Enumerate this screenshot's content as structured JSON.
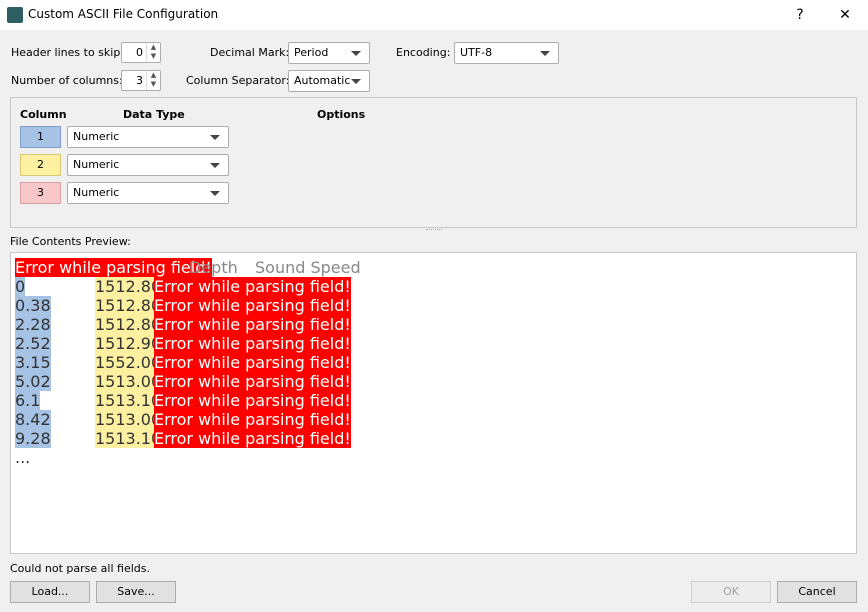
{
  "window": {
    "title": "Custom ASCII File Configuration",
    "help": "?",
    "close": "✕"
  },
  "settings": {
    "header_lines_label": "Header lines to skip:",
    "header_lines": "0",
    "num_columns_label": "Number of columns:",
    "num_columns": "3",
    "decimal_mark_label": "Decimal Mark:",
    "decimal_mark": "Period",
    "column_separator_label": "Column Separator:",
    "column_separator": "Automatic",
    "encoding_label": "Encoding:",
    "encoding": "UTF-8"
  },
  "columns": {
    "header_column": "Column",
    "header_type": "Data Type",
    "header_options": "Options",
    "rows": [
      {
        "num": "1",
        "type": "Numeric",
        "color": "#a6c2e4"
      },
      {
        "num": "2",
        "type": "Numeric",
        "color": "#fdf0a0"
      },
      {
        "num": "3",
        "type": "Numeric",
        "color": "#f8c8c8"
      }
    ]
  },
  "preview": {
    "label": "File Contents Preview:",
    "header": [
      "Error while parsing field!",
      "Depth",
      "Sound Speed"
    ],
    "rows": [
      [
        "0",
        "1512.80"
      ],
      [
        "0.38",
        "1512.80"
      ],
      [
        "2.28",
        "1512.80"
      ],
      [
        "2.52",
        "1512.90"
      ],
      [
        "3.15",
        "1552.00"
      ],
      [
        "5.02",
        "1513.00"
      ],
      [
        "6.1",
        "1513.10"
      ],
      [
        "8.42",
        "1513.00"
      ],
      [
        "9.28",
        "1513.10"
      ]
    ],
    "error_text": "Error while parsing field!",
    "ellipsis": "..."
  },
  "status": "Could not parse all fields.",
  "buttons": {
    "load": "Load...",
    "save": "Save...",
    "ok": "OK",
    "cancel": "Cancel"
  }
}
